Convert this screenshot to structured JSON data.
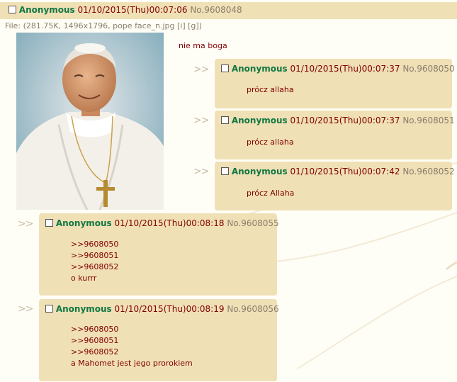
{
  "op": {
    "name": "Anonymous",
    "date": "01/10/2015(Thu)00:07:06",
    "number": "No.9608048",
    "file": {
      "prefix": "File:",
      "details": "(281.75K, 1496x1796, pope face_n.jpg",
      "link_i": "[i]",
      "link_g": "[g])"
    },
    "text": "nie ma boga"
  },
  "arrow": ">>",
  "replies": [
    {
      "name": "Anonymous",
      "date": "01/10/2015(Thu)00:07:37",
      "number": "No.9608050",
      "lines": [
        "prócz allaha"
      ]
    },
    {
      "name": "Anonymous",
      "date": "01/10/2015(Thu)00:07:37",
      "number": "No.9608051",
      "lines": [
        "prócz allaha"
      ]
    },
    {
      "name": "Anonymous",
      "date": "01/10/2015(Thu)00:07:42",
      "number": "No.9608052",
      "lines": [
        "prócz Allaha"
      ]
    },
    {
      "name": "Anonymous",
      "date": "01/10/2015(Thu)00:08:18",
      "number": "No.9608055",
      "lines": [
        ">>9608050",
        ">>9608051",
        ">>9608052",
        "o kurrr"
      ]
    },
    {
      "name": "Anonymous",
      "date": "01/10/2015(Thu)00:08:19",
      "number": "No.9608056",
      "lines": [
        ">>9608050",
        ">>9608051",
        ">>9608052",
        "a Mahomet jest jego prorokiem"
      ]
    }
  ],
  "colors": {
    "name": "#117743",
    "post_bg": "#f0e0b6",
    "text": "#800000",
    "muted": "#8a7d6b",
    "page_bg": "#fffef6"
  }
}
